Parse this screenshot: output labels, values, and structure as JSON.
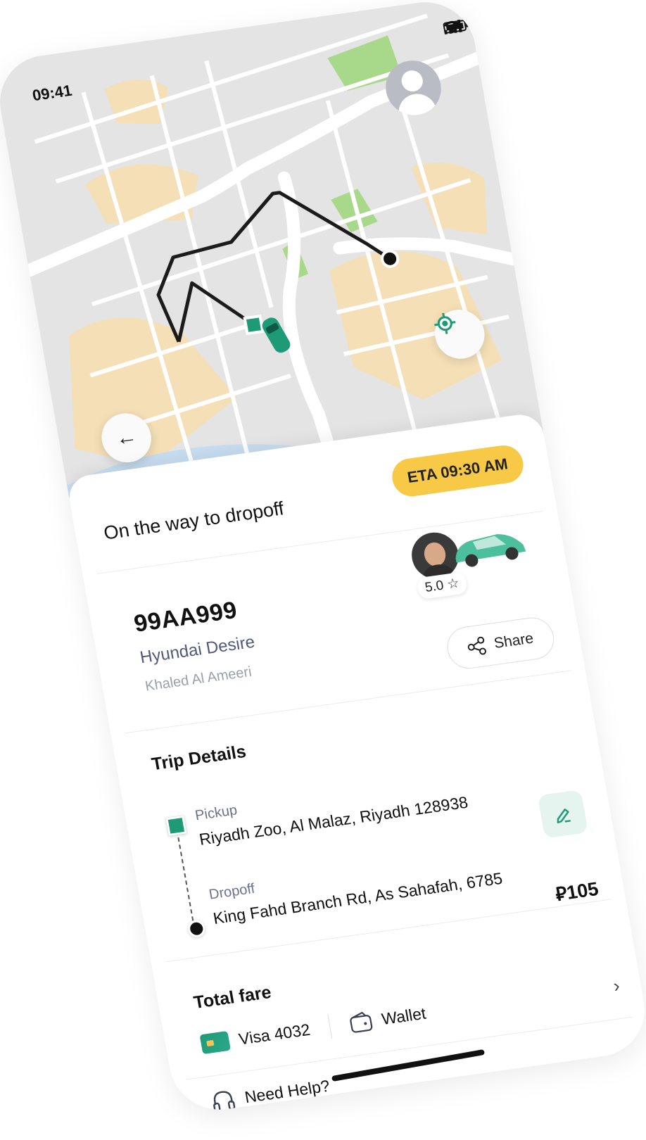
{
  "status_bar": {
    "time": "09:41"
  },
  "colors": {
    "accent": "#1f9a76",
    "eta_badge": "#f8c947",
    "map_base": "#e4e4e4",
    "map_sand": "#f4dfb6",
    "map_park": "#a8d98a",
    "water": "#c7ddf0"
  },
  "map": {
    "icons": [
      "profile-avatar",
      "locate-icon",
      "back-arrow-icon",
      "car-icon"
    ]
  },
  "trip_status": {
    "title": "On the way to dropoff",
    "eta": "ETA 09:30 AM"
  },
  "vehicle": {
    "plate": "99AA999",
    "model": "Hyundai Desire",
    "driver": "Khaled Al Ameeri",
    "rating": "5.0",
    "share_label": "Share"
  },
  "trip_details": {
    "title": "Trip Details",
    "pickup_label": "Pickup",
    "pickup_address": "Riyadh Zoo, Al Malaz, Riyadh 128938",
    "dropoff_label": "Dropoff",
    "dropoff_address": "King Fahd Branch Rd, As Sahafah, 6785",
    "fare": "⃁105"
  },
  "payment": {
    "title": "Total fare",
    "card": "Visa 4032",
    "wallet": "Wallet"
  },
  "help": {
    "label": "Need Help?"
  }
}
